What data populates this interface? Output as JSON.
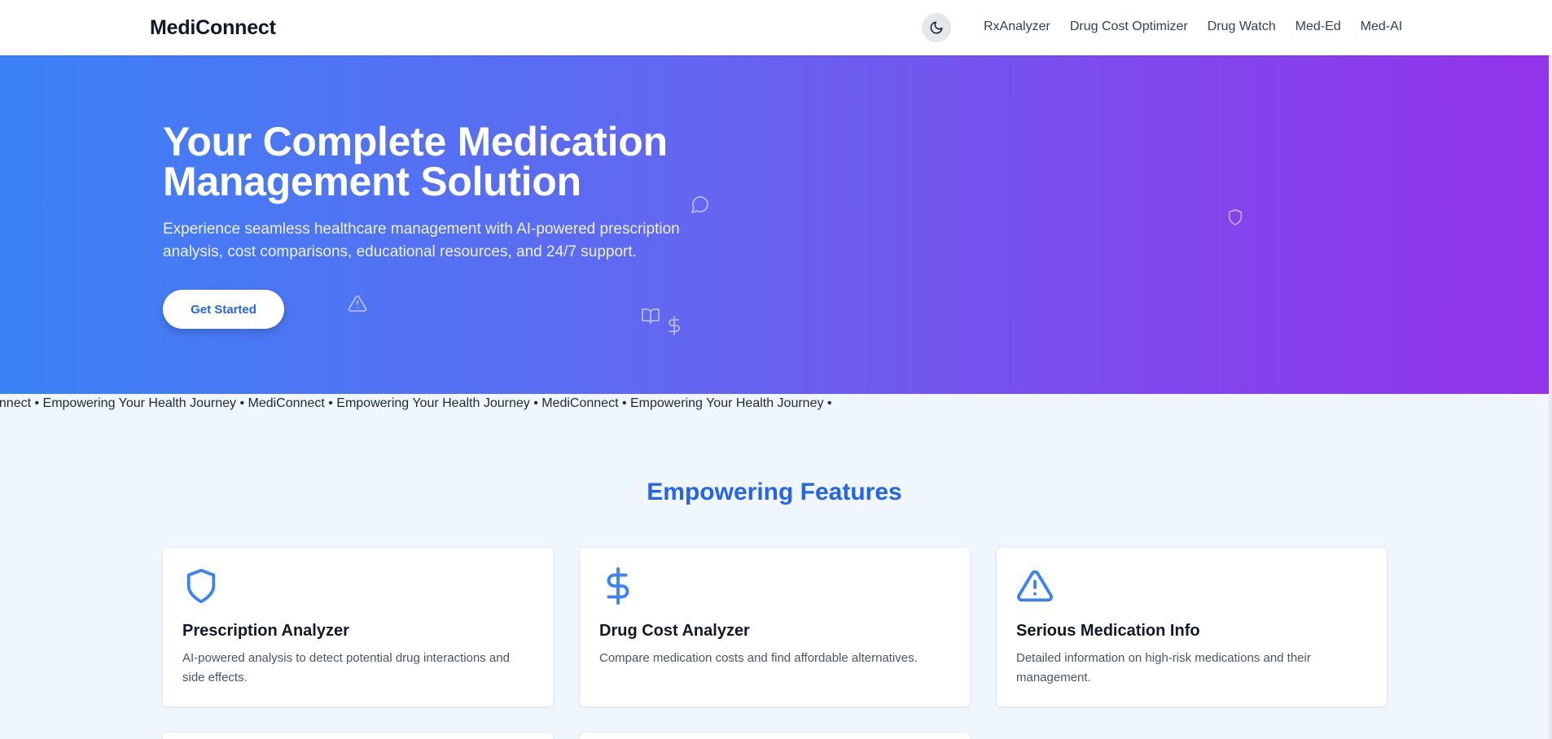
{
  "header": {
    "brand": "MediConnect",
    "theme_toggle_icon": "moon-icon",
    "nav": [
      "RxAnalyzer",
      "Drug Cost Optimizer",
      "Drug Watch",
      "Med-Ed",
      "Med-AI"
    ]
  },
  "hero": {
    "title": "Your Complete Medication Management Solution",
    "subtitle": "Experience seamless healthcare management with AI-powered prescription analysis, cost comparisons, educational resources, and 24/7 support.",
    "cta_label": "Get Started",
    "gradient": [
      "#3b82f6",
      "#9333ea"
    ],
    "floating_icons": [
      "chat-icon",
      "shield-icon",
      "warning-icon",
      "book-icon",
      "dollar-icon"
    ]
  },
  "marquee": {
    "text": "onnect • Empowering Your Health Journey • MediConnect • Empowering Your Health Journey • MediConnect • Empowering Your Health Journey •"
  },
  "features": {
    "title": "Empowering Features",
    "accent": "#2563eb",
    "cards": [
      {
        "icon": "shield-icon",
        "title": "Prescription Analyzer",
        "description": "AI-powered analysis to detect potential drug interactions and side effects."
      },
      {
        "icon": "dollar-icon",
        "title": "Drug Cost Analyzer",
        "description": "Compare medication costs and find affordable alternatives."
      },
      {
        "icon": "warning-icon",
        "title": "Serious Medication Info",
        "description": "Detailed information on high-risk medications and their management."
      }
    ]
  }
}
